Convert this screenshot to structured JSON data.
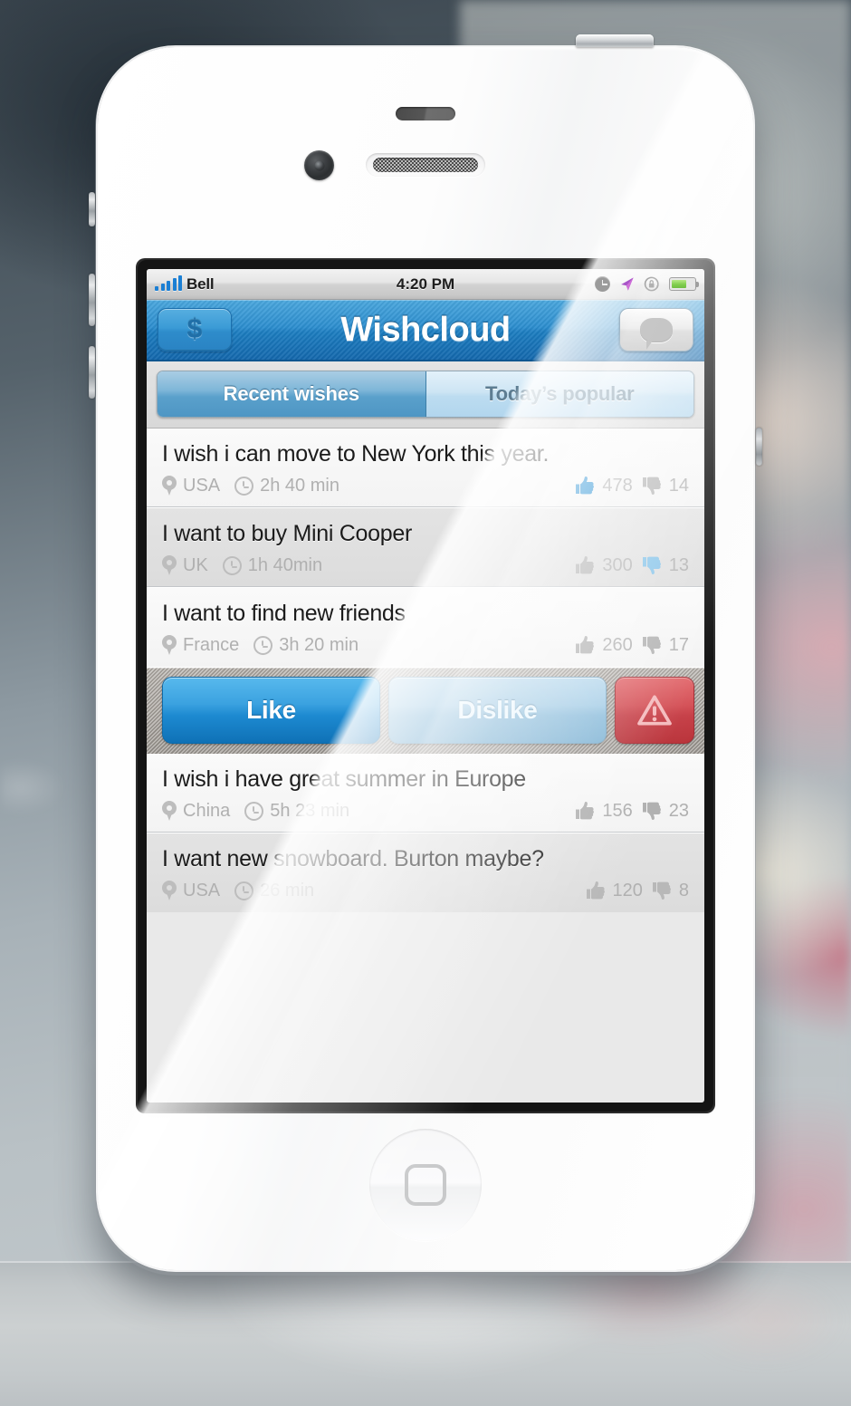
{
  "statusbar": {
    "carrier": "Bell",
    "time": "4:20 PM",
    "signal_bars": 5,
    "icons": [
      "clock-icon",
      "location-arrow-icon",
      "rotation-lock-icon",
      "battery-icon"
    ],
    "battery_level": "66%"
  },
  "navbar": {
    "title": "Wishcloud",
    "left_button_label": "$",
    "left_button_icon": "dollar-icon",
    "right_button_icon": "chat-bubble-icon"
  },
  "tabs": [
    {
      "label": "Recent wishes",
      "active": true
    },
    {
      "label": "Today’s popular",
      "active": false
    }
  ],
  "wishes": [
    {
      "title": "I wish i can move to New York this year.",
      "location": "USA",
      "time": "2h 40 min",
      "likes": "478",
      "dislikes": "14",
      "liked": true,
      "disliked": false
    },
    {
      "title": "I want to buy Mini Cooper",
      "location": "UK",
      "time": "1h 40min",
      "likes": "300",
      "dislikes": "13",
      "liked": false,
      "disliked": true
    },
    {
      "title": "I want to find new friends",
      "location": "France",
      "time": "3h 20 min",
      "likes": "260",
      "dislikes": "17",
      "liked": false,
      "disliked": false
    },
    {
      "title": "I wish i have great summer in Europe",
      "location": "China",
      "time": "5h 23 min",
      "likes": "156",
      "dislikes": "23",
      "liked": false,
      "disliked": false
    },
    {
      "title": "I want new snowboard. Burton maybe?",
      "location": "USA",
      "time": "26 min",
      "likes": "120",
      "dislikes": "8",
      "liked": false,
      "disliked": false
    }
  ],
  "action_bar": {
    "like_label": "Like",
    "dislike_label": "Dislike",
    "report_icon": "warning-triangle-icon"
  },
  "colors": {
    "accent_blue": "#1d8ad1",
    "nav_blue": "#2c8ecf",
    "report_red": "#c63e46",
    "muted_gray": "#b0b0b0"
  }
}
